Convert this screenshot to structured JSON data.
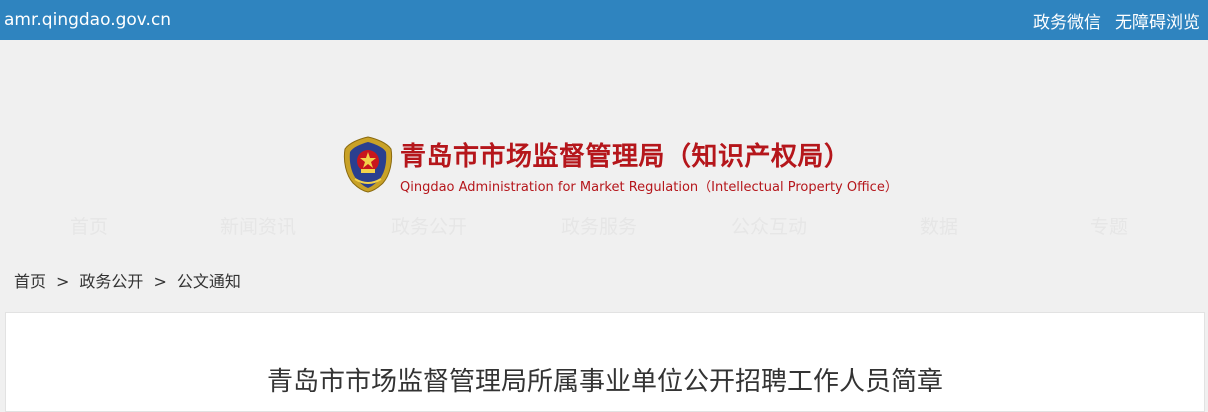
{
  "topbar": {
    "domain": "amr.qingdao.gov.cn",
    "links": [
      "政务微信",
      "无障碍浏览"
    ]
  },
  "header": {
    "title_zh": "青岛市市场监督管理局（知识产权局）",
    "title_en": "Qingdao Administration for Market Regulation（Intellectual Property Office）"
  },
  "nav": [
    "首页",
    "新闻资讯",
    "政务公开",
    "政务服务",
    "公众互动",
    "数据",
    "专题"
  ],
  "breadcrumb": {
    "items": [
      "首页",
      "政务公开",
      "公文通知"
    ],
    "separator": ">"
  },
  "article": {
    "title": "青岛市市场监督管理局所属事业单位公开招聘工作人员简章"
  },
  "colors": {
    "topbar": "#2f84bf",
    "brand_red": "#b5161b",
    "background": "#f0f0f0"
  }
}
